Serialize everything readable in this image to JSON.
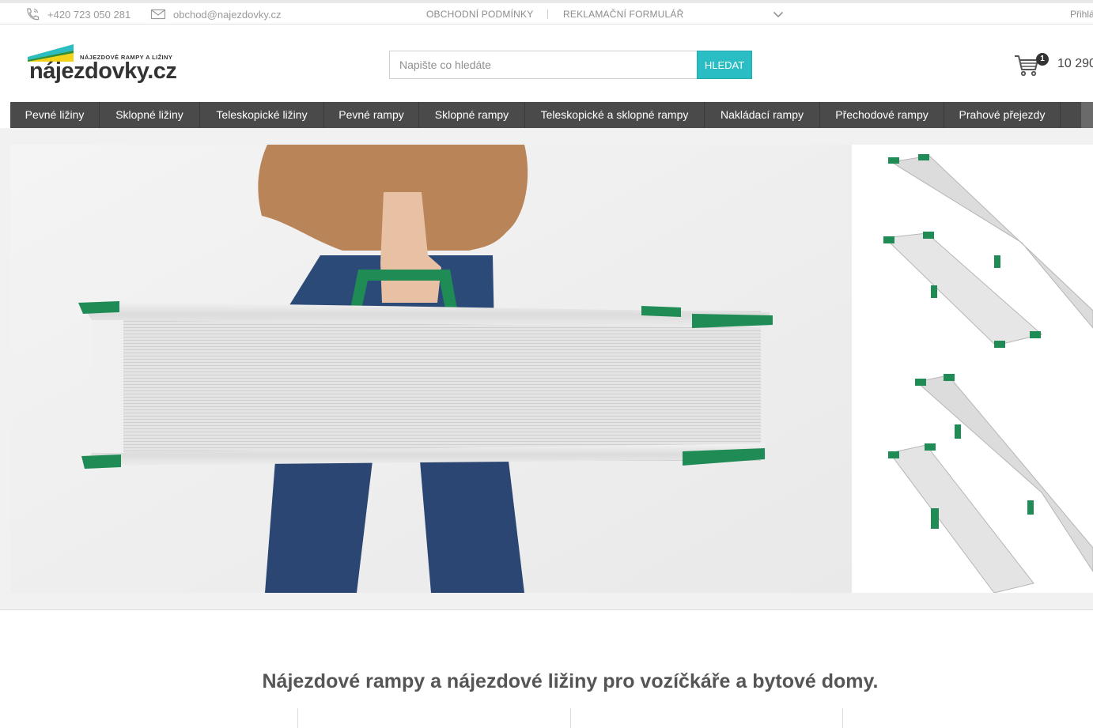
{
  "topbar": {
    "phone": "+420 723 050 281",
    "email": "obchod@najezdovky.cz",
    "links": [
      "OBCHODNÍ PODMÍNKY",
      "REKLAMAČNÍ FORMULÁŘ"
    ],
    "login": "Přihlá"
  },
  "logo": {
    "tagline": "NÁJEZDOVÉ RAMPY A LIŽINY",
    "name": "nájezdovky.cz",
    "colors": {
      "yellow": "#f2d21a",
      "teal": "#2bbdc4",
      "green": "#2f8f3a"
    }
  },
  "search": {
    "placeholder": "Napište co hledáte",
    "button": "HLEDAT"
  },
  "cart": {
    "count": "1",
    "price": "10 290"
  },
  "nav": {
    "items": [
      "Pevné ližiny",
      "Sklopné ližiny",
      "Teleskopické ližiny",
      "Pevné rampy",
      "Sklopné rampy",
      "Teleskopické a sklopné rampy",
      "Nakládací rampy",
      "Přechodové rampy",
      "Prahové přejezdy"
    ]
  },
  "intro": {
    "heading": "Nájezdové rampy a nájezdové ližiny pro vozíčkáře a bytové domy."
  },
  "colors": {
    "accent": "#2bbdc4",
    "nav_bg": "#4a4a4a",
    "ramp_green": "#1f8c55"
  }
}
